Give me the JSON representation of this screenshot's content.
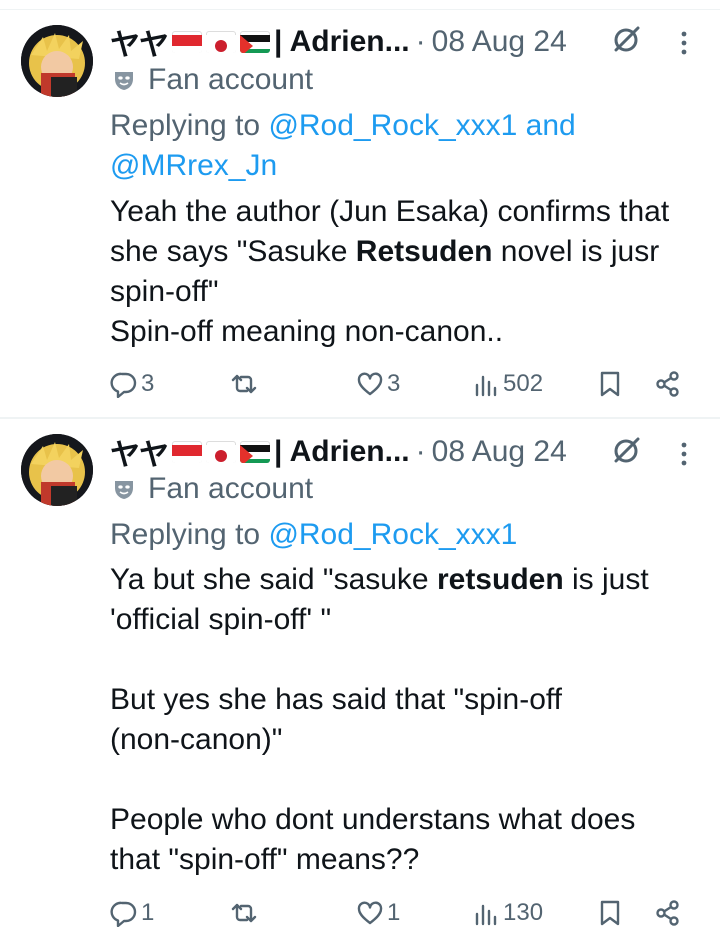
{
  "tweets": [
    {
      "kana": "ヤヤ",
      "display_name": "| Adrien...",
      "separator": "·",
      "date": "08 Aug 24",
      "label": "Fan account",
      "reply_prefix": "Replying to ",
      "reply_mentions": "@Rod_Rock_xxx1 and",
      "reply_mentions_2": "@MRrex_Jn",
      "body_before": "Yeah the author (Jun Esaka) confirms that she says \"Sasuke ",
      "body_bold": "Retsuden",
      "body_after": " novel is jusr spin-off\"\nSpin-off meaning non-canon..",
      "replies": "3",
      "likes": "3",
      "views": "502"
    },
    {
      "kana": "ヤヤ",
      "display_name": "| Adrien...",
      "separator": "·",
      "date": "08 Aug 24",
      "label": "Fan account",
      "reply_prefix": "Replying to ",
      "reply_mentions": "@Rod_Rock_xxx1",
      "body_before": "Ya but she said \"sasuke ",
      "body_bold": "retsuden",
      "body_after": " is just\n'official spin-off' \"\n\nBut yes she has said that \"spin-off\n(non-canon)\"\n\nPeople who dont understans what does\nthat \"spin-off\" means??",
      "replies": "1",
      "likes": "1",
      "views": "130"
    }
  ],
  "icons": [
    "avatar",
    "flag-indonesia-icon",
    "flag-japan-icon",
    "flag-palestine-icon",
    "mute-icon",
    "more-icon",
    "fan-mask-icon",
    "reply-icon",
    "retweet-icon",
    "like-icon",
    "views-icon",
    "bookmark-icon",
    "share-icon"
  ],
  "colors": {
    "link": "#1d9bf0",
    "muted": "#536471",
    "text": "#0f1419"
  }
}
